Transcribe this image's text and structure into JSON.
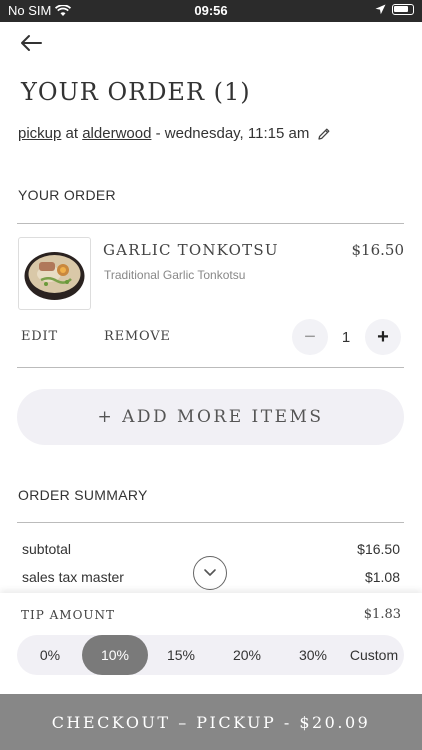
{
  "status_bar": {
    "carrier": "No SIM",
    "time": "09:56"
  },
  "page": {
    "title": "YOUR ORDER (1)"
  },
  "pickup": {
    "mode": "pickup",
    "at": "at",
    "location": "alderwood",
    "when": "- wednesday, 11:15 am"
  },
  "order": {
    "section_label": "YOUR ORDER",
    "item": {
      "name": "GARLIC TONKOTSU",
      "price": "$16.50",
      "description": "Traditional Garlic Tonkotsu",
      "edit_label": "EDIT",
      "remove_label": "REMOVE",
      "quantity": "1",
      "minus": "−",
      "plus": "+"
    },
    "add_more_label": "+ ADD MORE ITEMS"
  },
  "summary": {
    "section_label": "ORDER SUMMARY",
    "rows": [
      {
        "label": "subtotal",
        "value": "$16.50"
      },
      {
        "label": "sales tax master",
        "value": "$1.08"
      }
    ]
  },
  "tip": {
    "label": "TIP AMOUNT",
    "amount": "$1.83",
    "options": [
      "0%",
      "10%",
      "15%",
      "20%",
      "30%",
      "Custom"
    ],
    "selected": "10%"
  },
  "checkout": {
    "label": "CHECKOUT – PICKUP - $20.09"
  },
  "colors": {
    "accent_gray": "#878787",
    "pill_bg": "#f1f0f5",
    "selected_tip": "#7a7a7a"
  }
}
